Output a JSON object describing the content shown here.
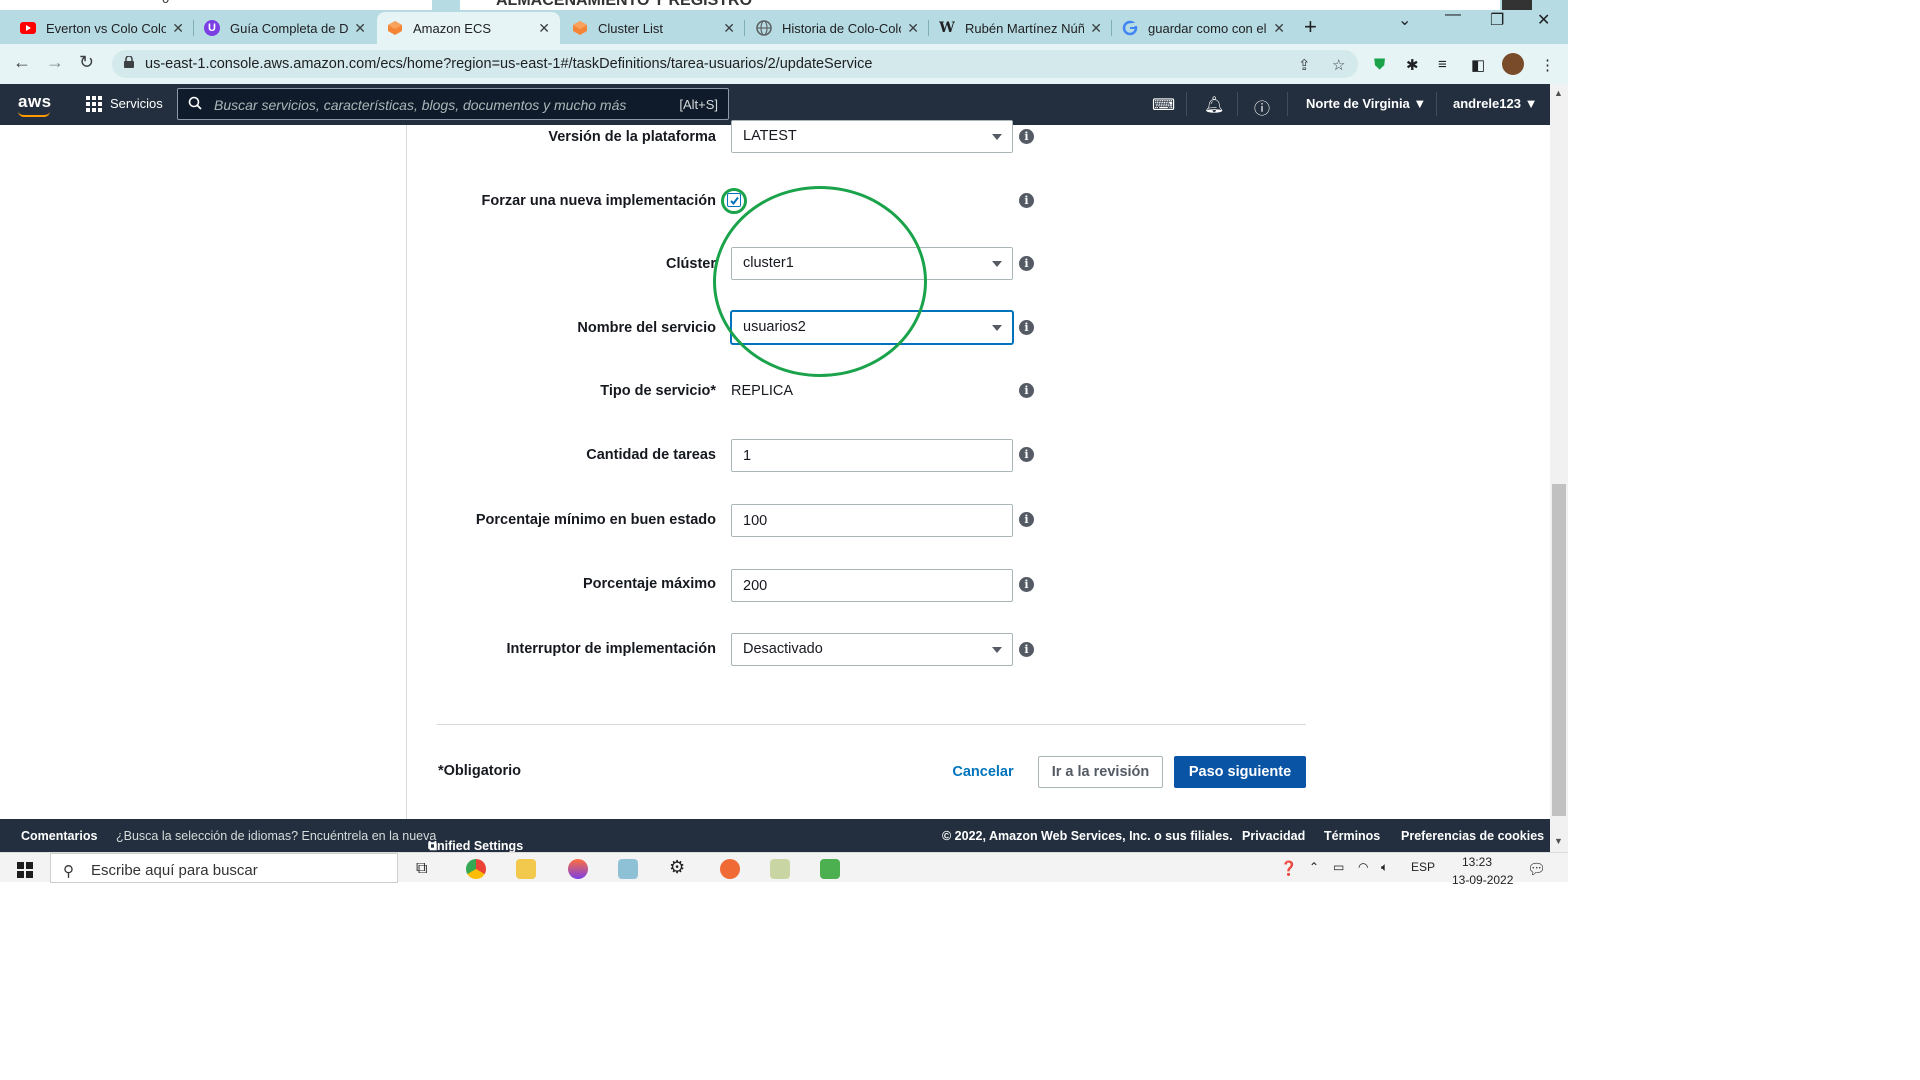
{
  "background_doc": {
    "left_text": "0",
    "right_text": "ALMACENAMIENTO Y REGISTRO"
  },
  "tabs": [
    {
      "label": "Everton vs Colo Colo (",
      "fav_color": "#ff0000"
    },
    {
      "label": "Guía Completa de Do",
      "fav_color": "#7b3fe4"
    },
    {
      "label": "Amazon ECS",
      "fav_color": "#f58536"
    },
    {
      "label": "Cluster List",
      "fav_color": "#f58536"
    },
    {
      "label": "Historia de Colo-Colo",
      "fav_color": "#5f6368"
    },
    {
      "label": "Rubén Martínez Núñe",
      "fav_color": "#ffffff"
    },
    {
      "label": "guardar como con el",
      "fav_color": "#ffffff"
    }
  ],
  "browser": {
    "url": "us-east-1.console.aws.amazon.com/ecs/home?region=us-east-1#/taskDefinitions/tarea-usuarios/2/updateService"
  },
  "aws_nav": {
    "logo": "aws",
    "services": "Servicios",
    "search_placeholder": "Buscar servicios, características, blogs, documentos y mucho más",
    "search_shortcut": "[Alt+S]",
    "region": "Norte de Virginia",
    "user": "andrele123"
  },
  "form": {
    "platform_label": "Versión de la plataforma",
    "platform_value": "LATEST",
    "force_label": "Forzar una nueva implementación",
    "force_checked": true,
    "cluster_label": "Clúster",
    "cluster_value": "cluster1",
    "service_name_label": "Nombre del servicio",
    "service_name_value": "usuarios2",
    "service_type_label": "Tipo de servicio*",
    "service_type_value": "REPLICA",
    "tasks_label": "Cantidad de tareas",
    "tasks_value": "1",
    "min_healthy_label": "Porcentaje mínimo en buen estado",
    "min_healthy_value": "100",
    "max_label": "Porcentaje máximo",
    "max_value": "200",
    "breaker_label": "Interruptor de implementación",
    "breaker_value": "Desactivado",
    "required_note": "*Obligatorio",
    "cancel": "Cancelar",
    "review": "Ir a la revisión",
    "next": "Paso siguiente"
  },
  "footer": {
    "feedback": "Comentarios",
    "lang_prompt": "¿Busca la selección de idiomas? Encuéntrela en la nueva",
    "unified": "Unified Settings",
    "copyright": "© 2022, Amazon Web Services, Inc. o sus filiales.",
    "privacy": "Privacidad",
    "terms": "Términos",
    "cookies": "Preferencias de cookies"
  },
  "taskbar": {
    "search_placeholder": "Escribe aquí para buscar",
    "lang": "ESP",
    "time": "13:23",
    "date": "13-09-2022"
  },
  "colors": {
    "accent": "#0073bb",
    "primary_button": "#0a54a5",
    "annotation": "#1aa34a",
    "aws_nav": "#232f3e"
  }
}
